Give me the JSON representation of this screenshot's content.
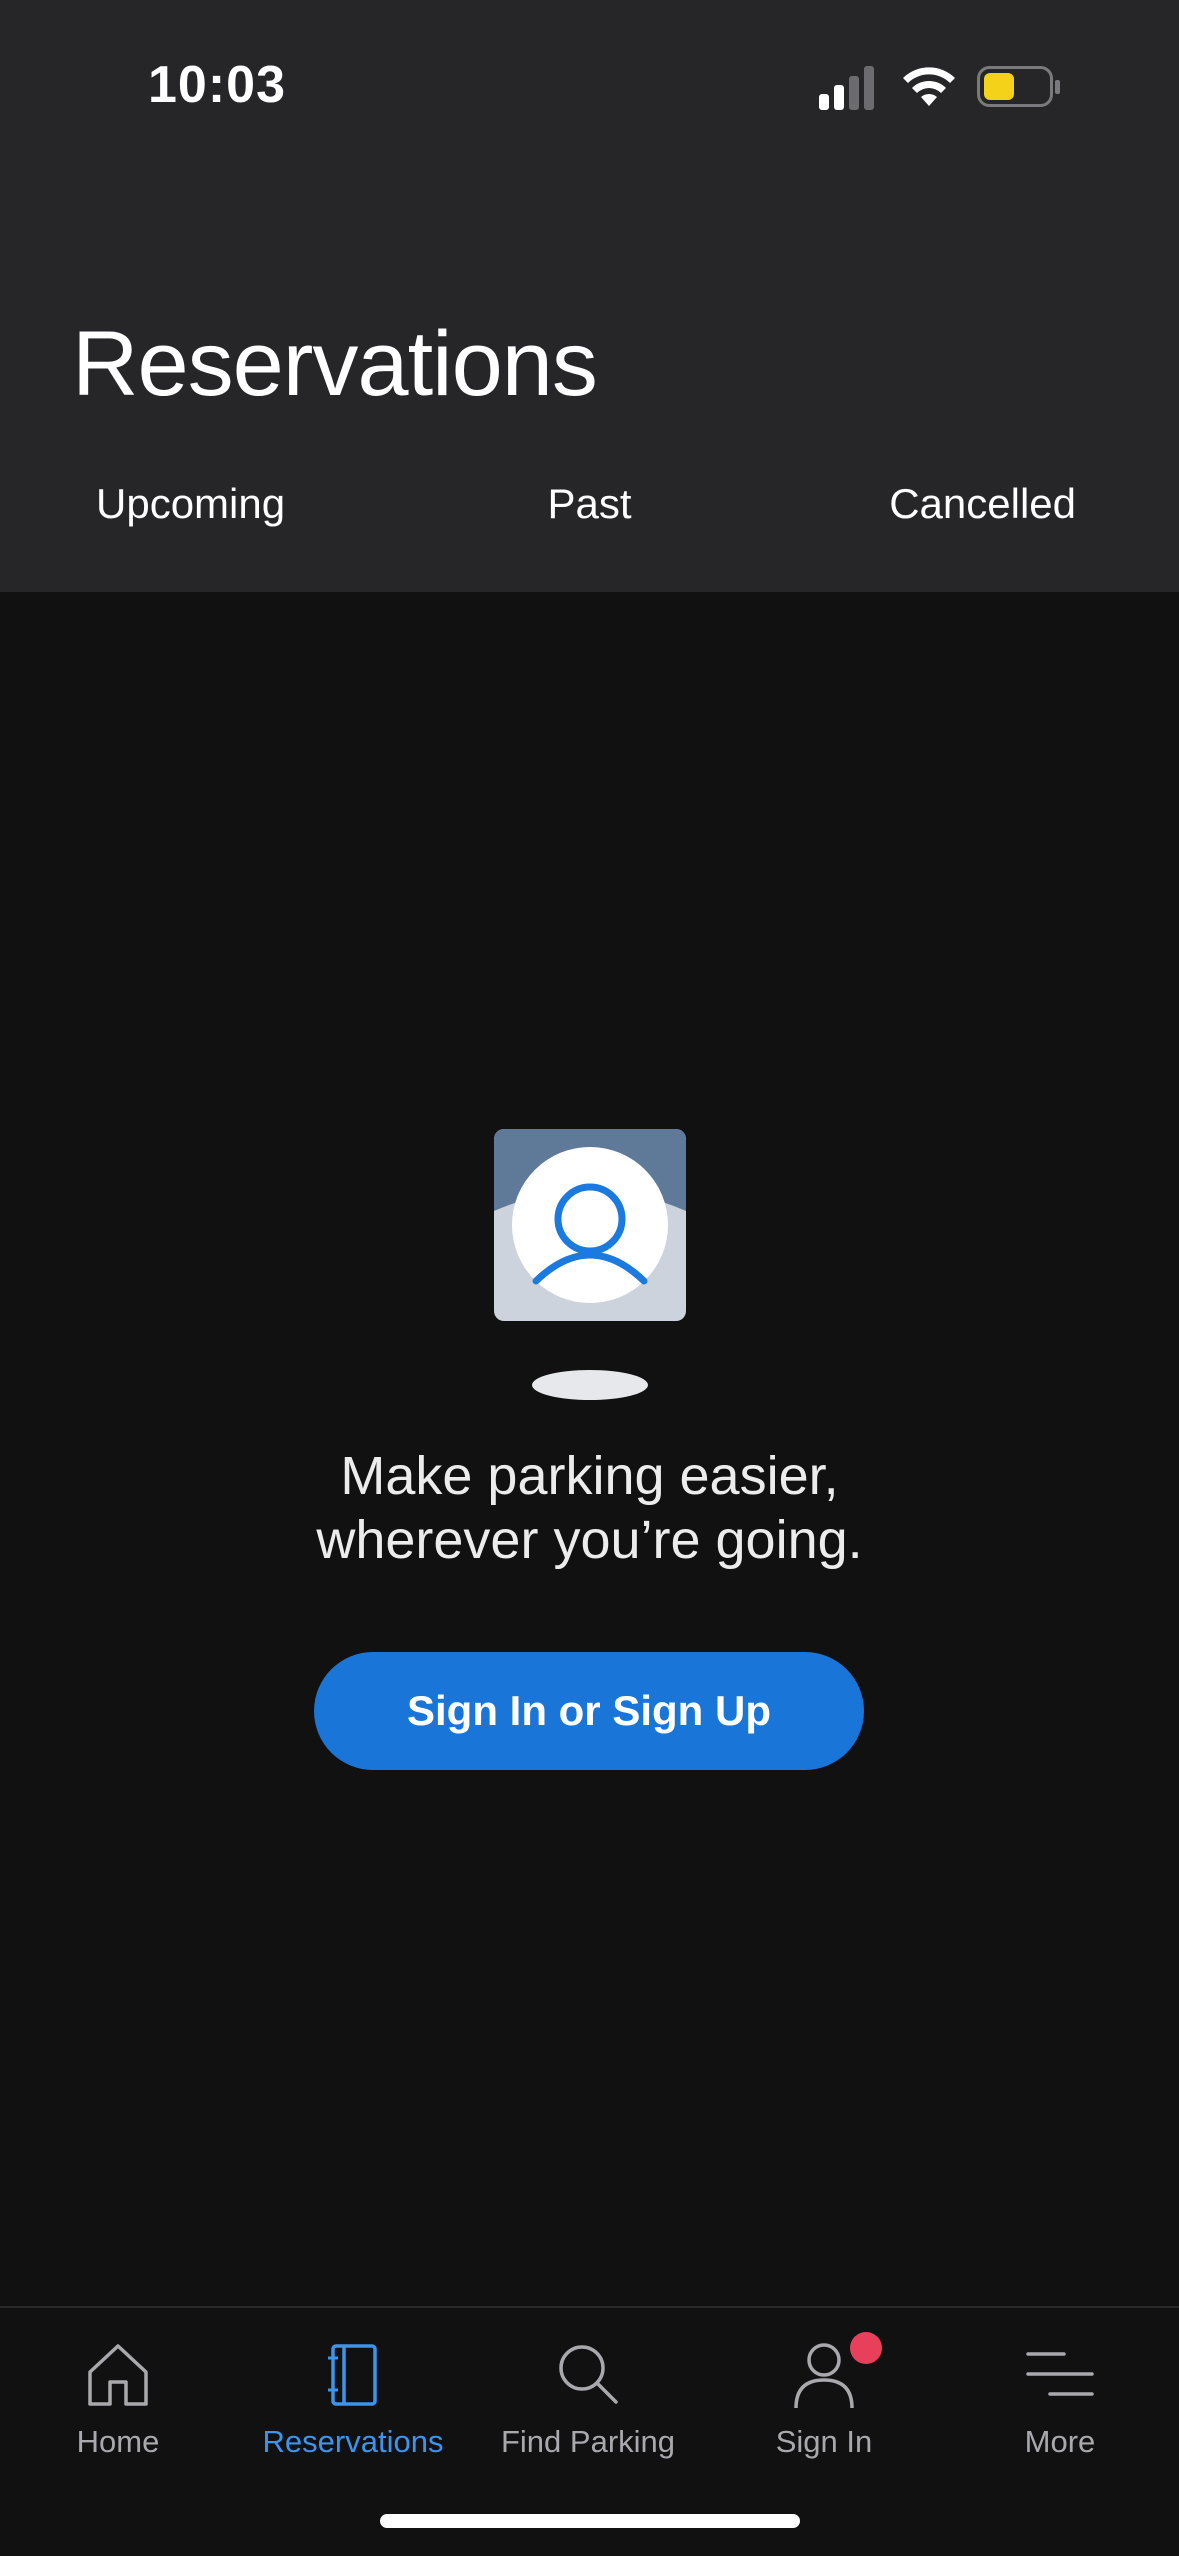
{
  "status_bar": {
    "time": "10:03",
    "icons": [
      "signal-icon",
      "wifi-icon",
      "battery-icon"
    ],
    "battery_color": "#f5d21a"
  },
  "header": {
    "title": "Reservations",
    "tabs": [
      {
        "label": "Upcoming"
      },
      {
        "label": "Past"
      },
      {
        "label": "Cancelled"
      }
    ]
  },
  "empty_state": {
    "icon": "user-avatar-icon",
    "message_line1": "Make parking easier,",
    "message_line2": "wherever you’re going.",
    "button_label": "Sign In or Sign Up"
  },
  "bottom_nav": {
    "items": [
      {
        "label": "Home",
        "icon": "home-icon"
      },
      {
        "label": "Reservations",
        "icon": "reservations-icon",
        "active": true
      },
      {
        "label": "Find Parking",
        "icon": "search-icon"
      },
      {
        "label": "Sign In",
        "icon": "person-icon",
        "badge": true
      },
      {
        "label": "More",
        "icon": "menu-icon"
      }
    ]
  },
  "colors": {
    "accent": "#1976d8",
    "active_tab": "#3d94ec",
    "header_bg": "#262628",
    "background": "#111112",
    "badge": "#e8405b"
  }
}
